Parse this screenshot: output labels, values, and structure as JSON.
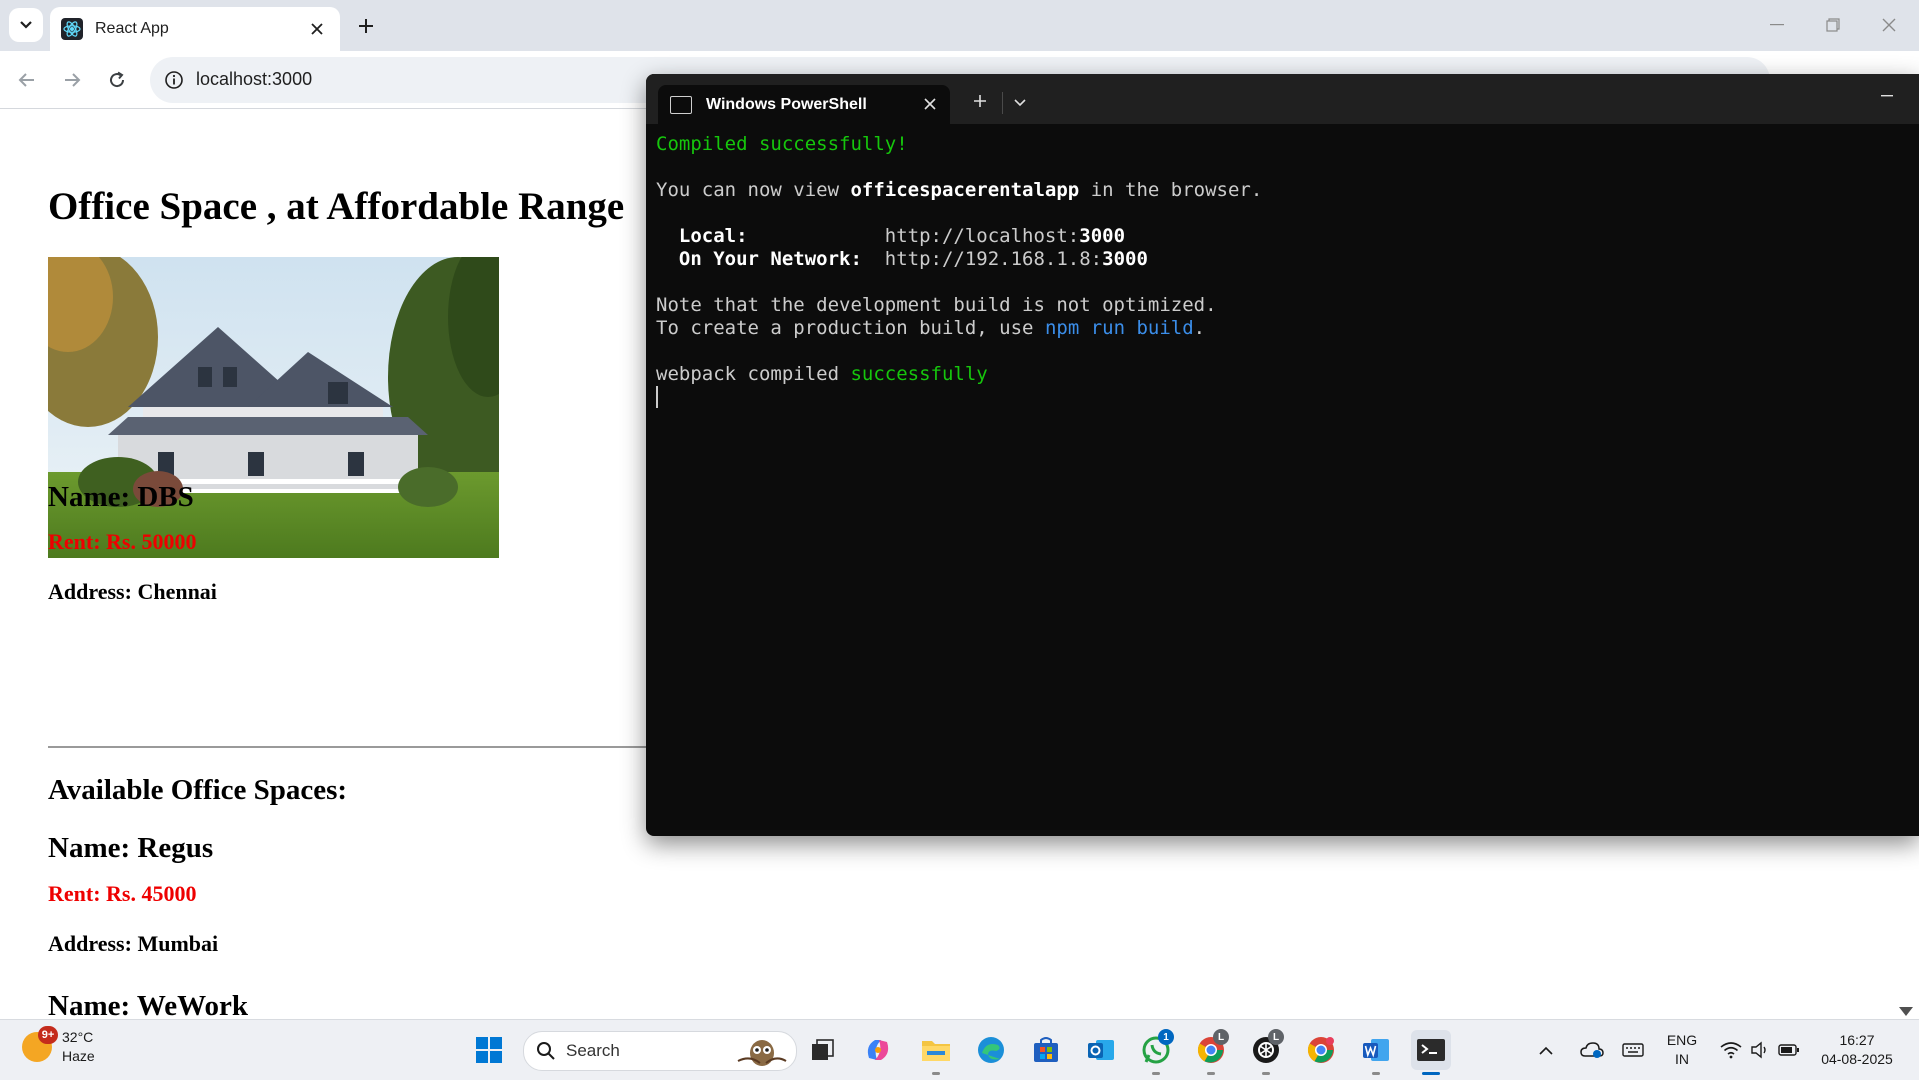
{
  "browser": {
    "tab_title": "React App",
    "url": "localhost:3000"
  },
  "page": {
    "heading": "Office Space , at Affordable Range",
    "image_alt": "house photo",
    "featured": {
      "name": "Name: DBS",
      "rent": "Rent: Rs. 50000",
      "address": "Address: Chennai"
    },
    "list_heading": "Available Office Spaces:",
    "items": [
      {
        "name": "Name: Regus",
        "rent": "Rent: Rs. 45000",
        "address": "Address: Mumbai"
      },
      {
        "name": "Name: WeWork"
      }
    ]
  },
  "terminal": {
    "tab_title": "Windows PowerShell",
    "lines": {
      "compiled": "Compiled successfully!",
      "view_prefix": "You can now view ",
      "app_name": "officespacerentalapp",
      "view_suffix": " in the browser.",
      "local_label": "  Local:",
      "local_url_prefix": "            http://localhost:",
      "local_port": "3000",
      "network_label": "  On Your Network:",
      "network_url_prefix": "  http://192.168.1.8:",
      "network_port": "3000",
      "note": "Note that the development build is not optimized.",
      "create_prefix": "To create a production build, use ",
      "npm_cmd": "npm run build",
      "create_suffix": ".",
      "webpack_prefix": "webpack compiled ",
      "webpack_status": "successfully"
    }
  },
  "taskbar": {
    "weather_temp": "32°C",
    "weather_desc": "Haze",
    "weather_badge": "9+",
    "search_placeholder": "Search",
    "whatsapp_badge": "1",
    "chrome_profile_badge": "L",
    "chatgpt_profile_badge": "L",
    "lang_primary": "ENG",
    "lang_secondary": "IN",
    "time": "16:27",
    "date": "04-08-2025"
  },
  "colors": {
    "rent": "#ee0000",
    "terminal_green": "#16c60c",
    "terminal_blue": "#3b8eea",
    "accent": "#0067c0"
  }
}
